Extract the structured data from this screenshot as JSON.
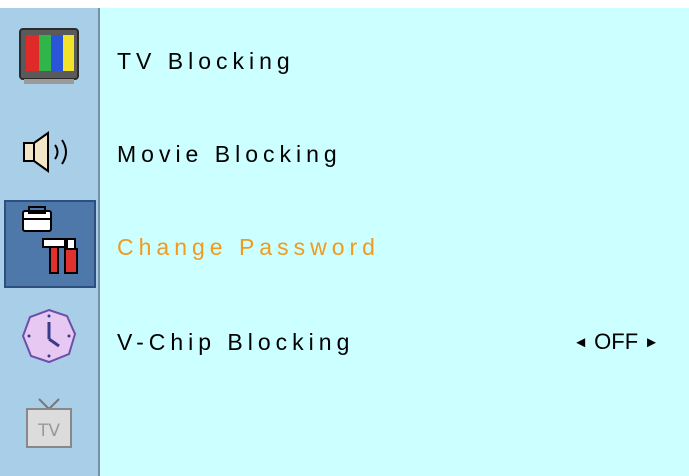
{
  "sidebar": {
    "items": [
      {
        "icon": "color-bars-icon"
      },
      {
        "icon": "speaker-icon"
      },
      {
        "icon": "toolbox-icon",
        "selected": true
      },
      {
        "icon": "clock-icon"
      },
      {
        "icon": "tv-icon"
      }
    ]
  },
  "menu": {
    "items": [
      {
        "label": "TV Blocking"
      },
      {
        "label": "Movie Blocking"
      },
      {
        "label": "Change Password",
        "active": true
      },
      {
        "label": "V-Chip Blocking",
        "value": "OFF"
      }
    ],
    "left_arrow": "◄",
    "right_arrow": "►"
  },
  "colors": {
    "content_bg": "#ccffff",
    "sidebar_bg": "#a9cfe8",
    "selected_bg": "#4e77aa",
    "active_text": "#f19a1d"
  }
}
